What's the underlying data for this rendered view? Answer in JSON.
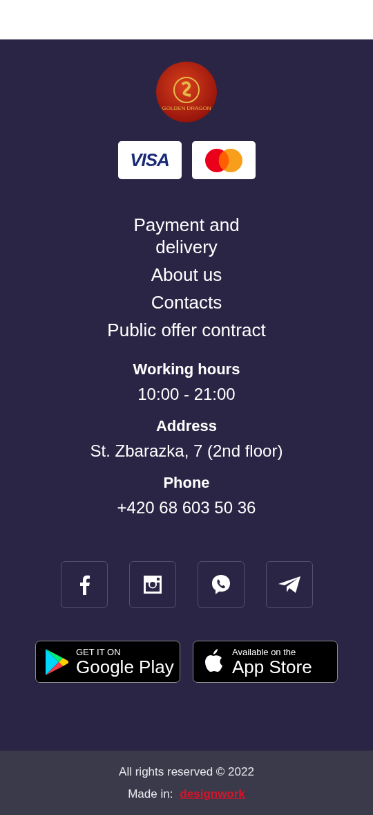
{
  "logo": {
    "caption": "GOLDEN DRAGON"
  },
  "payment_cards": [
    {
      "kind": "visa",
      "label": "VISA"
    },
    {
      "kind": "mastercard"
    }
  ],
  "links": [
    "Payment and delivery",
    "About us",
    "Contacts",
    "Public offer contract"
  ],
  "info": [
    {
      "heading": "Working hours",
      "value": "10:00 - 21:00"
    },
    {
      "heading": "Address",
      "value": "St. Zbarazka, 7 (2nd floor)"
    },
    {
      "heading": "Phone",
      "value": "+420 68 603 50 36"
    }
  ],
  "social": [
    {
      "kind": "facebook"
    },
    {
      "kind": "instagram"
    },
    {
      "kind": "viber"
    },
    {
      "kind": "telegram"
    }
  ],
  "stores": [
    {
      "kind": "google",
      "small": "GET IT ON",
      "big": "Google Play"
    },
    {
      "kind": "apple",
      "small": "Available on the",
      "big": "App Store"
    }
  ],
  "footer": {
    "copyright": "All rights reserved © 2022",
    "made_in": "Made in:",
    "maker": "designwork"
  }
}
